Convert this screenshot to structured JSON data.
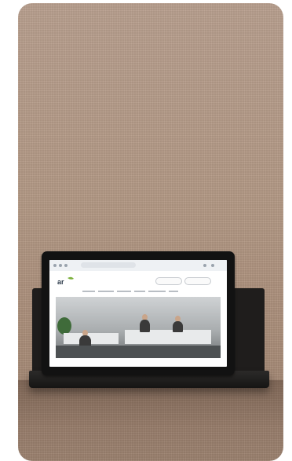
{
  "scene": {
    "subject": "tablet-on-wall-shelf",
    "wall_color": "#b39985",
    "tablet_color": "#121212",
    "shelf_color": "#1f1d1c",
    "accent_green": "#7bb03a"
  }
}
